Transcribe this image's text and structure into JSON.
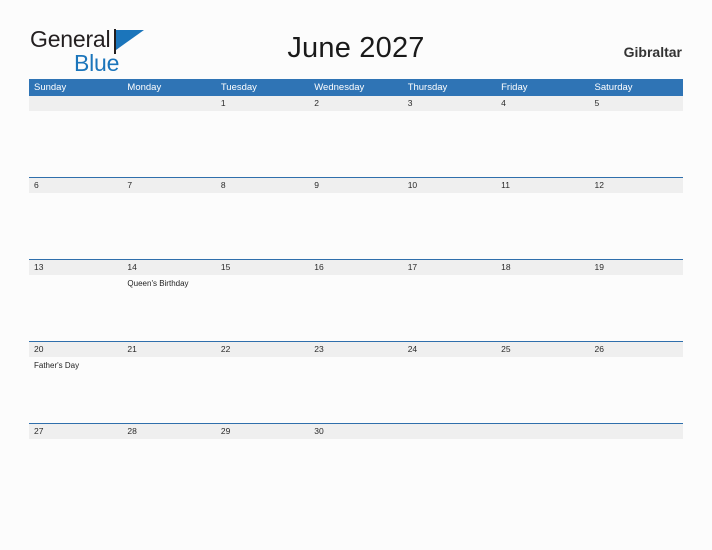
{
  "brand": {
    "name_part1": "General",
    "name_part2": "Blue",
    "flag_icon": "blue-triangle-flag-icon",
    "accent_color": "#1b75bb"
  },
  "header": {
    "title": "June 2027",
    "region": "Gibraltar"
  },
  "theme": {
    "header_blue": "#2f74b5",
    "divider_blue": "#2f6fac",
    "date_band_gray": "#efefef",
    "page_background": "#fcfcfc",
    "text_color": "#222222"
  },
  "calendar": {
    "month": "June",
    "year": "2027",
    "weekday_headers": [
      "Sunday",
      "Monday",
      "Tuesday",
      "Wednesday",
      "Thursday",
      "Friday",
      "Saturday"
    ],
    "weeks": [
      {
        "days": [
          {
            "date": "",
            "event": ""
          },
          {
            "date": "",
            "event": ""
          },
          {
            "date": "1",
            "event": ""
          },
          {
            "date": "2",
            "event": ""
          },
          {
            "date": "3",
            "event": ""
          },
          {
            "date": "4",
            "event": ""
          },
          {
            "date": "5",
            "event": ""
          }
        ]
      },
      {
        "days": [
          {
            "date": "6",
            "event": ""
          },
          {
            "date": "7",
            "event": ""
          },
          {
            "date": "8",
            "event": ""
          },
          {
            "date": "9",
            "event": ""
          },
          {
            "date": "10",
            "event": ""
          },
          {
            "date": "11",
            "event": ""
          },
          {
            "date": "12",
            "event": ""
          }
        ]
      },
      {
        "days": [
          {
            "date": "13",
            "event": ""
          },
          {
            "date": "14",
            "event": "Queen's Birthday"
          },
          {
            "date": "15",
            "event": ""
          },
          {
            "date": "16",
            "event": ""
          },
          {
            "date": "17",
            "event": ""
          },
          {
            "date": "18",
            "event": ""
          },
          {
            "date": "19",
            "event": ""
          }
        ]
      },
      {
        "days": [
          {
            "date": "20",
            "event": "Father's Day"
          },
          {
            "date": "21",
            "event": ""
          },
          {
            "date": "22",
            "event": ""
          },
          {
            "date": "23",
            "event": ""
          },
          {
            "date": "24",
            "event": ""
          },
          {
            "date": "25",
            "event": ""
          },
          {
            "date": "26",
            "event": ""
          }
        ]
      },
      {
        "days": [
          {
            "date": "27",
            "event": ""
          },
          {
            "date": "28",
            "event": ""
          },
          {
            "date": "29",
            "event": ""
          },
          {
            "date": "30",
            "event": ""
          },
          {
            "date": "",
            "event": ""
          },
          {
            "date": "",
            "event": ""
          },
          {
            "date": "",
            "event": ""
          }
        ]
      }
    ]
  }
}
